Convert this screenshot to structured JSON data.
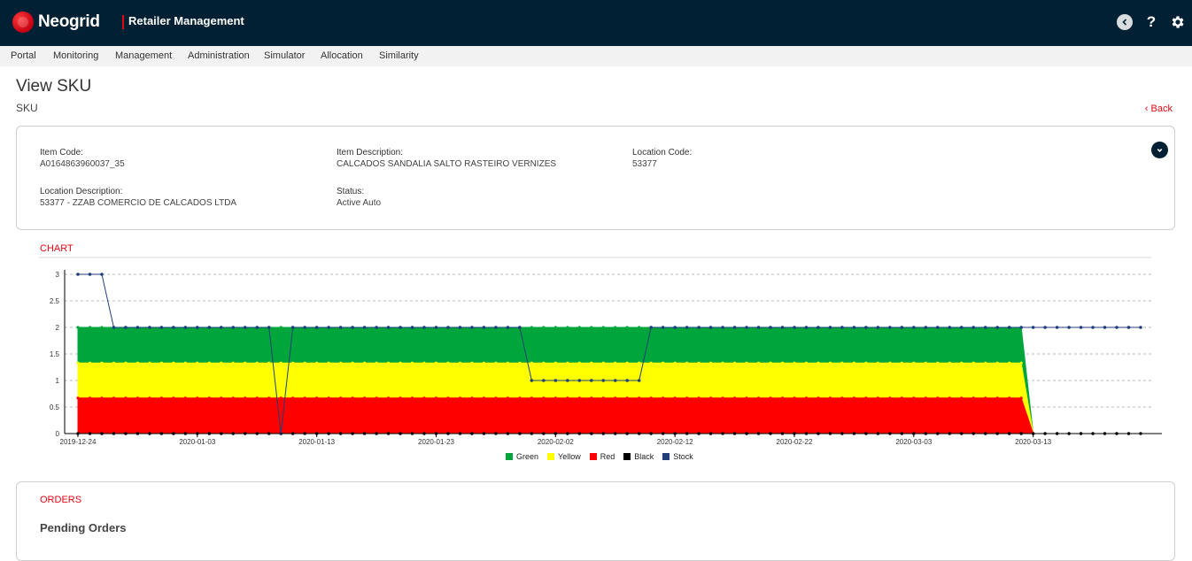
{
  "header": {
    "brand": "Neogrid",
    "app_title": "Retailer Management"
  },
  "icons": {
    "back": "circle-back-icon",
    "help": "question-icon",
    "settings": "gear-icon",
    "collapse": "chevron-circle-icon"
  },
  "menu": {
    "items": [
      "Portal",
      "Monitoring",
      "Management",
      "Administration",
      "Simulator",
      "Allocation",
      "Similarity"
    ]
  },
  "page": {
    "title": "View SKU",
    "subtitle": "SKU",
    "back": "Back"
  },
  "sku": {
    "item_code_label": "Item Code:",
    "item_code": "A0164863960037_35",
    "item_desc_label": "Item Description:",
    "item_desc": "CALCADOS SANDALIA SALTO RASTEIRO VERNIZES",
    "loc_code_label": "Location Code:",
    "loc_code": "53377",
    "loc_desc_label": "Location Description:",
    "loc_desc": "53377 - ZZAB COMERCIO DE CALCADOS LTDA",
    "status_label": "Status:",
    "status": "Active Auto"
  },
  "chart_section": {
    "title": "CHART"
  },
  "chart_data": {
    "type": "area",
    "x_start": "2019-12-24",
    "x_end": "2020-03-22",
    "x_ticks": [
      "2019-12-24",
      "2020-01-03",
      "2020-01-13",
      "2020-01-23",
      "2020-02-02",
      "2020-02-12",
      "2020-02-22",
      "2020-03-03",
      "2020-03-13"
    ],
    "ylim": [
      0,
      3
    ],
    "y_ticks": [
      0,
      0.5,
      1,
      1.5,
      2,
      2.5,
      3
    ],
    "grid": "horizontal-dashed",
    "legend": "bottom",
    "series": [
      {
        "name": "Green",
        "color": "#00a63c",
        "x": [
          "2019-12-24",
          "2020-03-12",
          "2020-03-13"
        ],
        "y": [
          2,
          2,
          0
        ]
      },
      {
        "name": "Yellow",
        "color": "#ffff00",
        "x": [
          "2019-12-24",
          "2020-03-12",
          "2020-03-13"
        ],
        "y": [
          1.33,
          1.33,
          0
        ]
      },
      {
        "name": "Red",
        "color": "#ff0000",
        "x": [
          "2019-12-24",
          "2020-03-12",
          "2020-03-13"
        ],
        "y": [
          0.67,
          0.67,
          0
        ]
      },
      {
        "name": "Black",
        "color": "#000000",
        "x": [
          "2019-12-24",
          "2020-03-22"
        ],
        "y": [
          0,
          0
        ]
      },
      {
        "name": "Stock",
        "color": "#1f3f7a",
        "x": [
          "2019-12-24",
          "2019-12-26",
          "2019-12-27",
          "2020-01-09",
          "2020-01-10",
          "2020-01-11",
          "2020-01-30",
          "2020-01-31",
          "2020-02-09",
          "2020-02-10",
          "2020-03-22"
        ],
        "y": [
          3,
          3,
          2,
          2,
          0,
          2,
          2,
          1,
          1,
          2,
          2
        ]
      }
    ]
  },
  "orders": {
    "title": "ORDERS",
    "pending": "Pending Orders"
  }
}
